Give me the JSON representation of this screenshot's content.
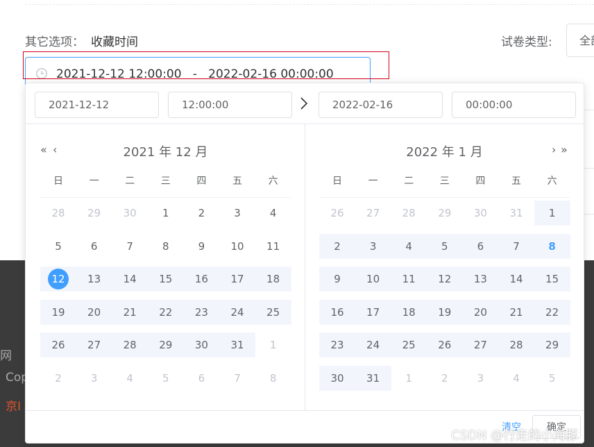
{
  "form": {
    "other_label": "其它选项：",
    "other_value": "收藏时间",
    "type_label": "试卷类型:",
    "type_value": "全部"
  },
  "range_input": {
    "start": "2021-12-12 12:00:00",
    "separator": "-",
    "end": "2022-02-16 00:00:00"
  },
  "picker": {
    "start_date": "2021-12-12",
    "start_time": "12:00:00",
    "end_date": "2022-02-16",
    "end_time": "00:00:00",
    "weekdays": [
      "日",
      "一",
      "二",
      "三",
      "四",
      "五",
      "六"
    ],
    "left_title": "2021 年 12 月",
    "right_title": "2022 年 1 月",
    "left_days": [
      [
        "28",
        "29",
        "30",
        "1",
        "2",
        "3",
        "4"
      ],
      [
        "5",
        "6",
        "7",
        "8",
        "9",
        "10",
        "11"
      ],
      [
        "12",
        "13",
        "14",
        "15",
        "16",
        "17",
        "18"
      ],
      [
        "19",
        "20",
        "21",
        "22",
        "23",
        "24",
        "25"
      ],
      [
        "26",
        "27",
        "28",
        "29",
        "30",
        "31",
        "1"
      ],
      [
        "2",
        "3",
        "4",
        "5",
        "6",
        "7",
        "8"
      ]
    ],
    "right_days": [
      [
        "26",
        "27",
        "28",
        "29",
        "30",
        "31",
        "1"
      ],
      [
        "2",
        "3",
        "4",
        "5",
        "6",
        "7",
        "8"
      ],
      [
        "9",
        "10",
        "11",
        "12",
        "13",
        "14",
        "15"
      ],
      [
        "16",
        "17",
        "18",
        "19",
        "20",
        "21",
        "22"
      ],
      [
        "23",
        "24",
        "25",
        "26",
        "27",
        "28",
        "29"
      ],
      [
        "30",
        "31",
        "1",
        "2",
        "3",
        "4",
        "5"
      ]
    ],
    "clear_label": "清空",
    "ok_label": "确定"
  },
  "background": {
    "footer_texts": [
      "网",
      "Cop",
      "京I"
    ]
  },
  "watermark": "CSDN @行走的小海豚",
  "colors": {
    "accent": "#409eff",
    "range_bg": "#f2f6fc",
    "highlight_frame": "#d0021b"
  }
}
